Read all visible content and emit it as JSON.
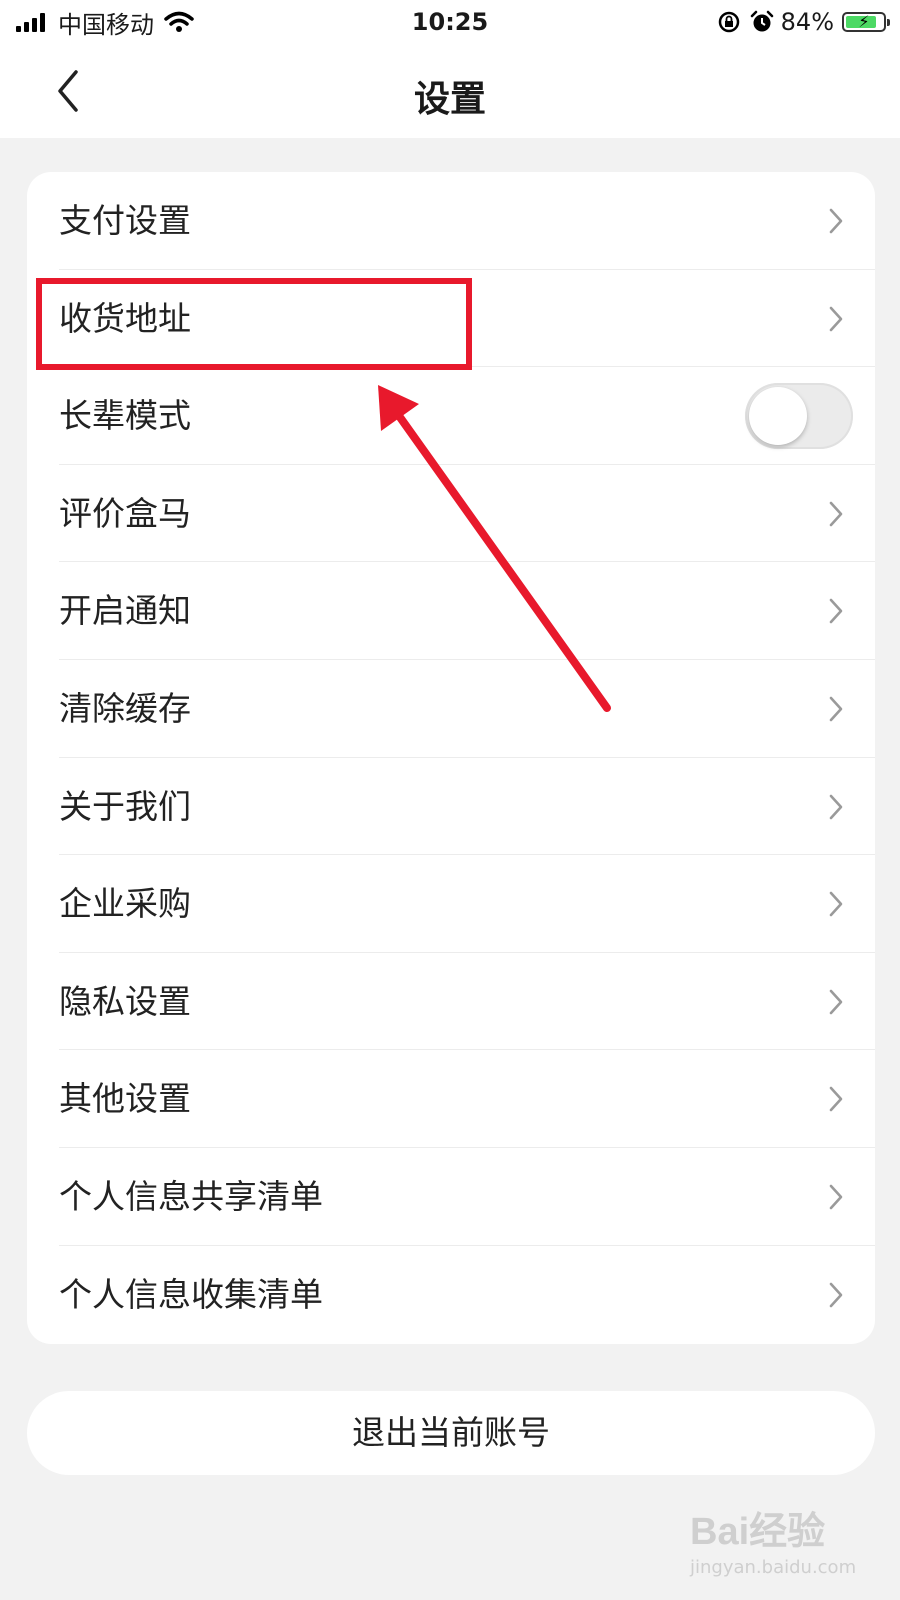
{
  "status_bar": {
    "carrier": "中国移动",
    "time": "10:25",
    "battery_percent": "84%",
    "battery_level": 0.84
  },
  "nav": {
    "title": "设置",
    "back_icon": "chevron-left-icon"
  },
  "settings": {
    "items": [
      {
        "label": "支付设置"
      },
      {
        "label": "收货地址"
      },
      {
        "label": "长辈模式",
        "toggle": false
      },
      {
        "label": "评价盒马"
      },
      {
        "label": "开启通知"
      },
      {
        "label": "清除缓存"
      },
      {
        "label": "关于我们"
      },
      {
        "label": "企业采购"
      },
      {
        "label": "隐私设置"
      },
      {
        "label": "其他设置"
      },
      {
        "label": "个人信息共享清单"
      },
      {
        "label": "个人信息收集清单"
      }
    ]
  },
  "logout": {
    "label": "退出当前账号"
  },
  "annotation": {
    "highlighted_item": "收货地址",
    "color": "#e8192c"
  },
  "watermark": {
    "logo": "Bai经验",
    "url": "jingyan.baidu.com"
  }
}
